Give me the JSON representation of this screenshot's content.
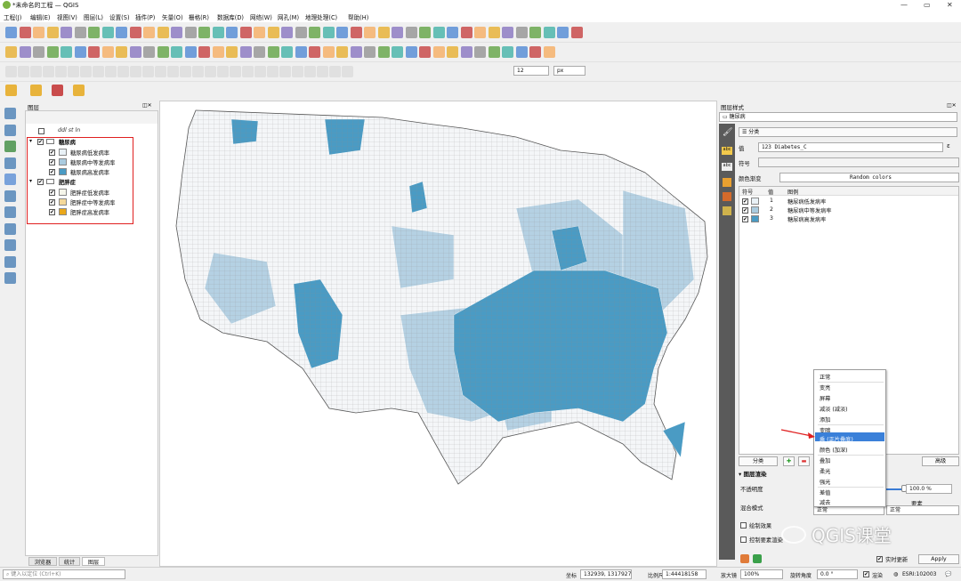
{
  "window": {
    "title": "*未命名的工程 — QGIS"
  },
  "menu": [
    "工程(J)",
    "编辑(E)",
    "视图(V)",
    "图层(L)",
    "设置(S)",
    "插件(P)",
    "矢量(O)",
    "栅格(R)",
    "数据库(D)",
    "网络(W)",
    "网孔(M)",
    "地理处理(C)",
    "帮助(H)"
  ],
  "toolbar": {
    "scale_value": "12",
    "unit": "px"
  },
  "layers_panel": {
    "title": "图层",
    "filter_text": "ddl st ln",
    "groups": [
      {
        "name": "糖尿病",
        "items": [
          {
            "label": "糖尿病低发病率",
            "color": "#e9f1f6"
          },
          {
            "label": "糖尿病中等发病率",
            "color": "#aacbdf"
          },
          {
            "label": "糖尿病高发病率",
            "color": "#4a9bc4"
          }
        ]
      },
      {
        "name": "肥胖症",
        "items": [
          {
            "label": "肥胖症低发病率",
            "color": "#f5f5ea"
          },
          {
            "label": "肥胖症中等发病率",
            "color": "#f4d89a"
          },
          {
            "label": "肥胖症高发病率",
            "color": "#eaa81b"
          }
        ]
      }
    ],
    "tabs": [
      "浏览器",
      "统计",
      "图层"
    ]
  },
  "style_panel": {
    "title": "图层样式",
    "layer": "糖尿病",
    "renderer": "分类",
    "value_label": "值",
    "value_field": "123 Diabetes_C",
    "symbol_label": "符号",
    "ramp_label": "颜色渐变",
    "ramp_value": "Random colors",
    "col_symbol": "符号",
    "col_value": "值",
    "col_legend": "图例",
    "classes": [
      {
        "value": "1",
        "legend": "糖尿病低发病率",
        "color": "#e9f1f6"
      },
      {
        "value": "2",
        "legend": "糖尿病中等发病率",
        "color": "#aacbdf"
      },
      {
        "value": "3",
        "legend": "糖尿病高发病率",
        "color": "#4a9bc4"
      }
    ],
    "classify_btn": "分类",
    "advanced_btn": "高级",
    "render_section": "图层渲染",
    "opacity_label": "不透明度",
    "opacity_value": "100.0 %",
    "blend_label": "混合模式",
    "blend_layer": "正常",
    "blend_feature": "正常",
    "feature_label": "要素",
    "draw_effects": "绘制效果",
    "control_order": "控制要素渲染",
    "live_update": "实时更新",
    "apply": "Apply"
  },
  "blend_menu": [
    "正常",
    "变亮",
    "屏幕",
    "减淡 (减淡)",
    "添加",
    "变暗",
    "乘 (正片叠底)",
    "颜色 (加深)",
    "叠加",
    "柔光",
    "强光",
    "差值",
    "减去"
  ],
  "watermark": "QGIS课堂",
  "statusbar": {
    "locate_placeholder": "键入以定位 (Ctrl+K)",
    "coord_label": "坐标",
    "coord_value": "132939, 1317927",
    "scale_label": "比例尺",
    "scale_value": "1:44418158",
    "magnifier_label": "放大镜",
    "magnifier_value": "100%",
    "rotation_label": "旋转角度",
    "rotation_value": "0.0 °",
    "render_label": "渲染",
    "crs": "ESRI:102003"
  }
}
